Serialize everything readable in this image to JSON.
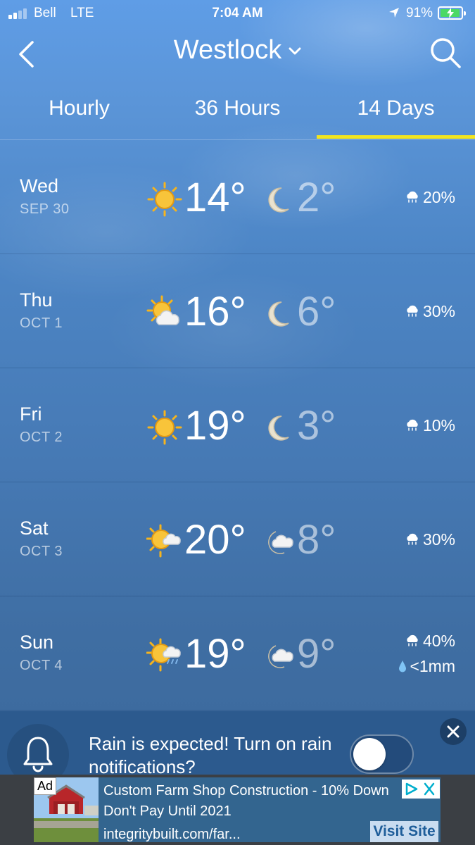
{
  "status_bar": {
    "carrier": "Bell",
    "network": "LTE",
    "time": "7:04 AM",
    "battery_percent": "91%",
    "battery_level": 0.91,
    "signal_bars": 2
  },
  "header": {
    "city": "Westlock"
  },
  "tabs": [
    {
      "label": "Hourly",
      "active": false
    },
    {
      "label": "36 Hours",
      "active": false
    },
    {
      "label": "14 Days",
      "active": true
    }
  ],
  "days": [
    {
      "day": "Wed",
      "date": "SEP 30",
      "high": "14°",
      "high_icon": "sunny-icon",
      "low": "2°",
      "low_icon": "moon-icon",
      "precip": "20%"
    },
    {
      "day": "Thu",
      "date": "OCT 1",
      "high": "16°",
      "high_icon": "sun-cloud-icon",
      "low": "6°",
      "low_icon": "moon-icon",
      "precip": "30%"
    },
    {
      "day": "Fri",
      "date": "OCT 2",
      "high": "19°",
      "high_icon": "sunny-icon",
      "low": "3°",
      "low_icon": "moon-icon",
      "precip": "10%"
    },
    {
      "day": "Sat",
      "date": "OCT 3",
      "high": "20°",
      "high_icon": "sun-cloud-icon",
      "low": "8°",
      "low_icon": "moon-cloud-icon",
      "precip": "30%"
    },
    {
      "day": "Sun",
      "date": "OCT 4",
      "high": "19°",
      "high_icon": "sun-cloud-rain-icon",
      "low": "9°",
      "low_icon": "moon-cloud-icon",
      "precip": "40%",
      "rain_amount": "<1mm"
    }
  ],
  "notification": {
    "text": "Rain is expected! Turn on rain notifications?",
    "toggle_on": false
  },
  "ad": {
    "badge": "Ad",
    "headline": "Custom Farm Shop Construction - 10% Down",
    "subline": "Don't Pay Until 2021",
    "url": "integritybuilt.com/far...",
    "cta": "Visit Site"
  },
  "colors": {
    "tab_indicator": "#f2e51e",
    "battery_fill": "#4cd964",
    "sun": "#f6b41d"
  }
}
